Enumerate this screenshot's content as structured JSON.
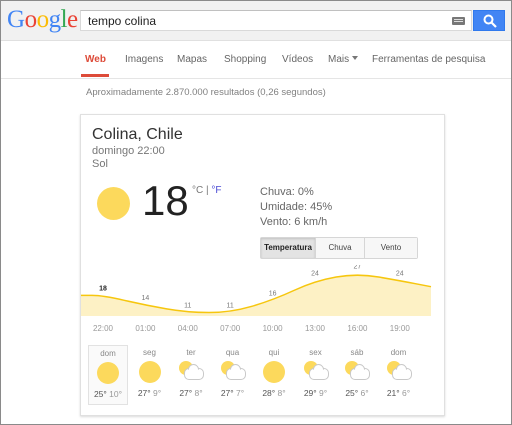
{
  "search": {
    "query": "tempo colina"
  },
  "nav": {
    "web": "Web",
    "images": "Imagens",
    "maps": "Mapas",
    "shopping": "Shopping",
    "videos": "Vídeos",
    "more": "Mais",
    "tools": "Ferramentas de pesquisa"
  },
  "stats": "Aproximadamente 2.870.000 resultados (0,26 segundos)",
  "weather": {
    "location": "Colina, Chile",
    "when": "domingo 22:00",
    "condition": "Sol",
    "temp": "18",
    "unit_c": "°C",
    "unit_sep": " | ",
    "unit_f": "°F",
    "rain": "Chuva: 0%",
    "humidity": "Umidade: 45%",
    "wind": "Vento: 6 km/h",
    "tabs": [
      "Temperatura",
      "Chuva",
      "Vento"
    ],
    "chart_color": "#f6c60e",
    "chart_fill": "#fdf1c5"
  },
  "chart_data": {
    "type": "area",
    "x": [
      "22:00",
      "01:00",
      "04:00",
      "07:00",
      "10:00",
      "13:00",
      "16:00",
      "19:00"
    ],
    "values": [
      18,
      14,
      11,
      11,
      16,
      24,
      27,
      24
    ],
    "xlabel": "",
    "ylabel": ""
  },
  "forecast": [
    {
      "day": "dom",
      "icon": "sun",
      "hi": "25°",
      "lo": "10°",
      "selected": true
    },
    {
      "day": "seg",
      "icon": "sun",
      "hi": "27°",
      "lo": "9°",
      "selected": false
    },
    {
      "day": "ter",
      "icon": "partly-cloudy",
      "hi": "27°",
      "lo": "8°",
      "selected": false
    },
    {
      "day": "qua",
      "icon": "partly-cloudy",
      "hi": "27°",
      "lo": "7°",
      "selected": false
    },
    {
      "day": "qui",
      "icon": "sun",
      "hi": "28°",
      "lo": "8°",
      "selected": false
    },
    {
      "day": "sex",
      "icon": "partly-cloudy",
      "hi": "29°",
      "lo": "9°",
      "selected": false
    },
    {
      "day": "sáb",
      "icon": "partly-cloudy",
      "hi": "25°",
      "lo": "6°",
      "selected": false
    },
    {
      "day": "dom",
      "icon": "partly-cloudy",
      "hi": "21°",
      "lo": "6°",
      "selected": false
    }
  ]
}
